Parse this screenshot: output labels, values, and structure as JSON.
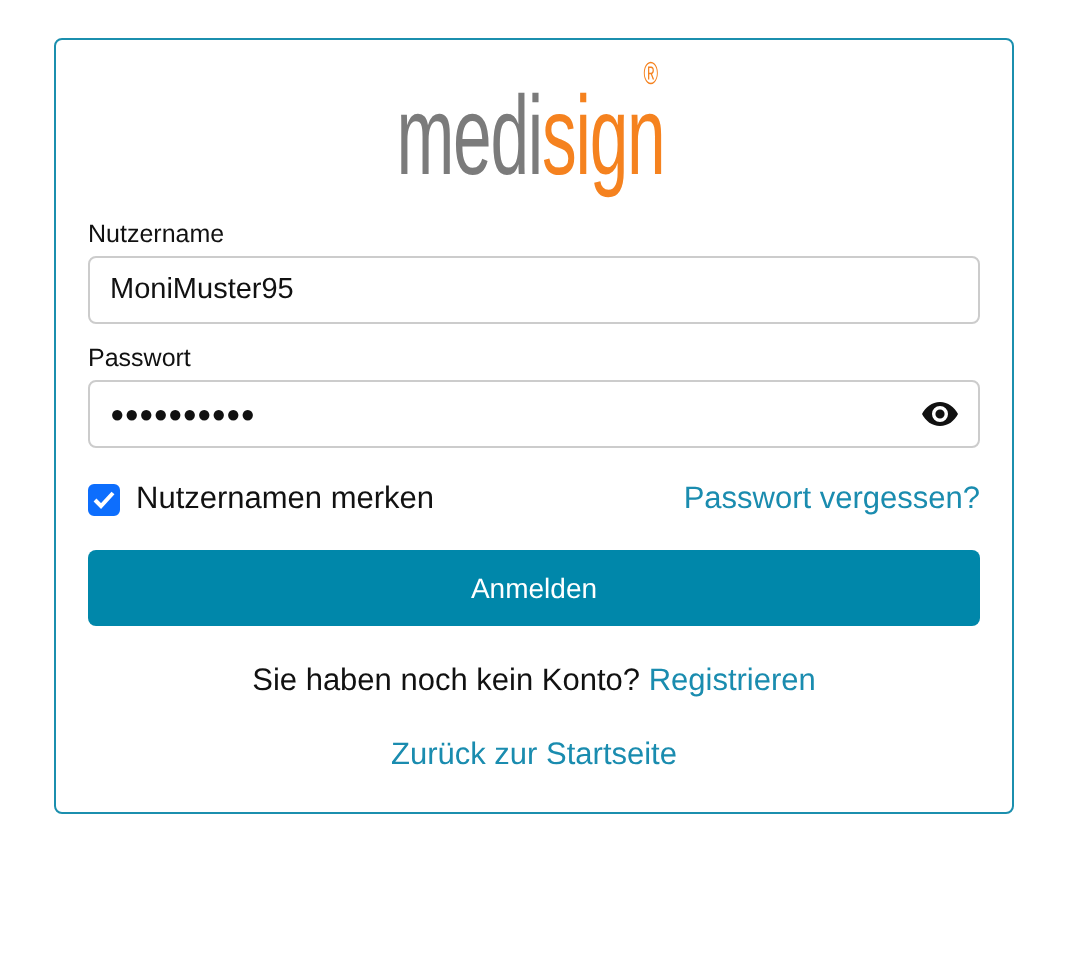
{
  "logo": {
    "parts": [
      {
        "text": "medi",
        "color": "#7b7b7b"
      },
      {
        "text": "sign",
        "color": "#f5821f"
      }
    ],
    "mark": "®"
  },
  "fields": [
    {
      "kind": "text",
      "label": "Nutzername",
      "value": "MoniMuster95"
    },
    {
      "kind": "password",
      "label": "Passwort",
      "value": "●●●●●●●●●●"
    }
  ],
  "remember": {
    "label": "Nutzernamen merken",
    "checked": true
  },
  "forgot_link": "Passwort vergessen?",
  "login_button": "Anmelden",
  "register": {
    "text": "Sie haben noch kein Konto?",
    "link": "Registrieren"
  },
  "back_link": "Zurück zur Startseite"
}
